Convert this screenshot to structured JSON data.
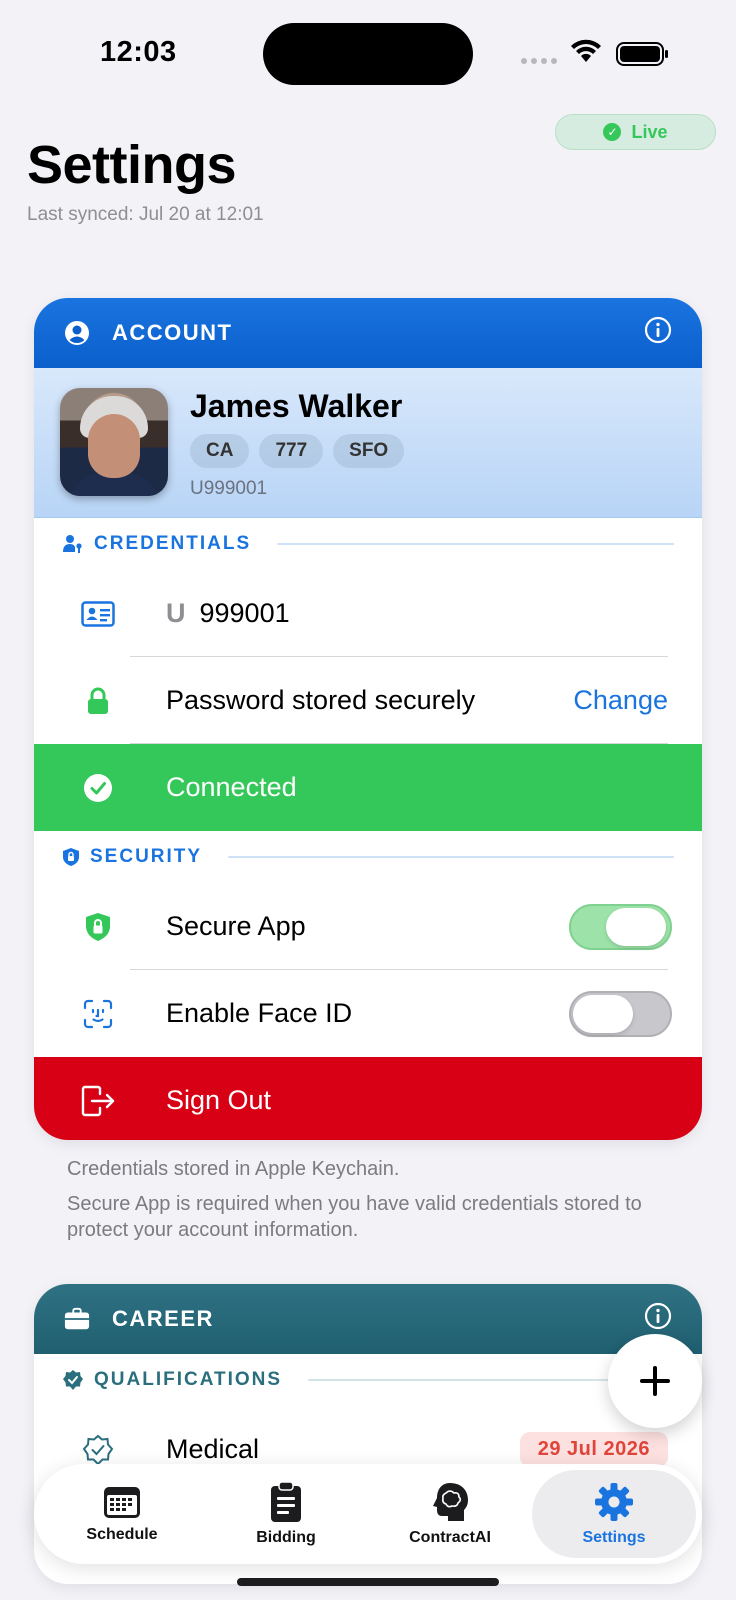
{
  "status_bar": {
    "time": "12:03"
  },
  "header": {
    "live_badge": "Live",
    "title": "Settings",
    "last_synced": "Last synced: Jul 20 at 12:01"
  },
  "account": {
    "header_title": "ACCOUNT",
    "profile": {
      "name": "James Walker",
      "chips": [
        "CA",
        "777",
        "SFO"
      ],
      "employee_id": "U999001"
    },
    "credentials": {
      "section_title": "CREDENTIALS",
      "username_prefix": "U",
      "username_value": "999001",
      "password_label": "Password stored securely",
      "change_label": "Change",
      "connected_label": "Connected"
    },
    "security": {
      "section_title": "SECURITY",
      "secure_app_label": "Secure App",
      "secure_app_on": true,
      "face_id_label": "Enable Face ID",
      "face_id_on": false
    },
    "sign_out_label": "Sign Out",
    "footnote_1": "Credentials stored in Apple Keychain.",
    "footnote_2": "Secure App is required when you have valid credentials stored to protect your account information."
  },
  "career": {
    "header_title": "CAREER",
    "qualifications": {
      "section_title": "QUALIFICATIONS",
      "medical_label": "Medical",
      "medical_date": "29 Jul 2026"
    }
  },
  "tabs": [
    {
      "label": "Schedule",
      "icon": "calendar-icon",
      "active": false
    },
    {
      "label": "Bidding",
      "icon": "clipboard-icon",
      "active": false
    },
    {
      "label": "ContractAI",
      "icon": "brain-head-icon",
      "active": false
    },
    {
      "label": "Settings",
      "icon": "gear-icon",
      "active": true
    }
  ],
  "colors": {
    "accent": "#1a74e0",
    "connected": "#34c759",
    "sign_out": "#d70015",
    "career": "#2b6e7e"
  }
}
